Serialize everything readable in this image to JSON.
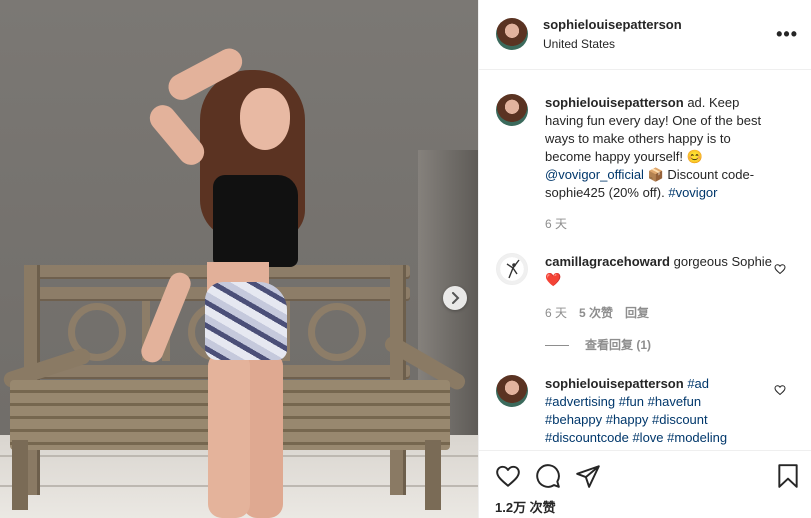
{
  "post": {
    "author": "sophielouisepatterson",
    "location": "United States",
    "more_label": "•••"
  },
  "caption": {
    "author": "sophielouisepatterson",
    "text_1": "ad. Keep having fun every day! One of the best ways to make others happy is to become happy yourself! ",
    "emoji": "😊",
    "mention": "@vovigor_official",
    "text_2": " 📦 Discount code-sophie425 (20% off). ",
    "hashtag": "#vovigor",
    "time": "6 天"
  },
  "comment1": {
    "author": "camillagracehoward",
    "text": "gorgeous Sophie",
    "emoji": "❤️",
    "time": "6 天",
    "likes": "5 次赞",
    "reply": "回复",
    "view_replies": "查看回复 (1)"
  },
  "comment2": {
    "author": "sophielouisepatterson",
    "tags": "#ad #advertising #fun #havefun #behappy #happy #discount #discountcode #love #modeling"
  },
  "footer": {
    "likes_count": "1.2万 次赞"
  },
  "icons": {
    "like": "heart-outline-icon",
    "comment": "comment-bubble-icon",
    "share": "paper-plane-icon",
    "save": "bookmark-icon",
    "next": "chevron-right-icon"
  },
  "colors": {
    "link": "#00376b",
    "muted": "#8e8e8e",
    "text": "#262626",
    "heart_red": "#ed4956"
  }
}
